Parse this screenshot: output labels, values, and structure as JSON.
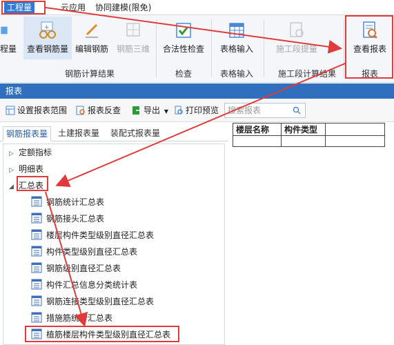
{
  "menubar": {
    "tabs": [
      {
        "label": "工程量",
        "active": true
      },
      {
        "label": "云应用",
        "active": false
      },
      {
        "label": "协同建模(限免)",
        "active": false
      }
    ]
  },
  "ribbon": {
    "buttons": {
      "partial": "程量",
      "view_rebar": "查看钢筋量",
      "edit_rebar": "编辑钢筋",
      "rebar_3d": "钢筋三维",
      "legality": "合法性检查",
      "table_input": "表格输入",
      "section_qty": "施工段提量",
      "view_report": "查看报表"
    },
    "groups": {
      "rebar_result": "钢筋计算结果",
      "check": "检查",
      "table_input": "表格输入",
      "section_result": "施工段计算结果",
      "report": "报表"
    }
  },
  "report_panel": {
    "title": "报表",
    "toolbar": {
      "set_range": "设置报表范围",
      "reverse_check": "报表反查",
      "export": "导出",
      "print_preview": "打印预览",
      "search_placeholder": "搜索报表"
    },
    "subtabs": [
      "钢筋报表量",
      "土建报表量",
      "装配式报表量"
    ],
    "tree": {
      "quota": "定额指标",
      "detail": "明细表",
      "summary": "汇总表",
      "summary_items": [
        "钢筋统计汇总表",
        "钢筋接头汇总表",
        "楼层构件类型级别直径汇总表",
        "构件类型级别直径汇总表",
        "钢筋级别直径汇总表",
        "构件汇总信息分类统计表",
        "钢筋连接类型级别直径汇总表",
        "措施筋统计汇总表",
        "植筋楼层构件类型级别直径汇总表"
      ]
    },
    "preview_table": {
      "headers": [
        "楼层名称",
        "构件类型",
        ""
      ]
    }
  },
  "colors": {
    "accent": "#2e7bd6",
    "titlebar": "#2f6fbd",
    "highlight": "#e03a3a"
  }
}
